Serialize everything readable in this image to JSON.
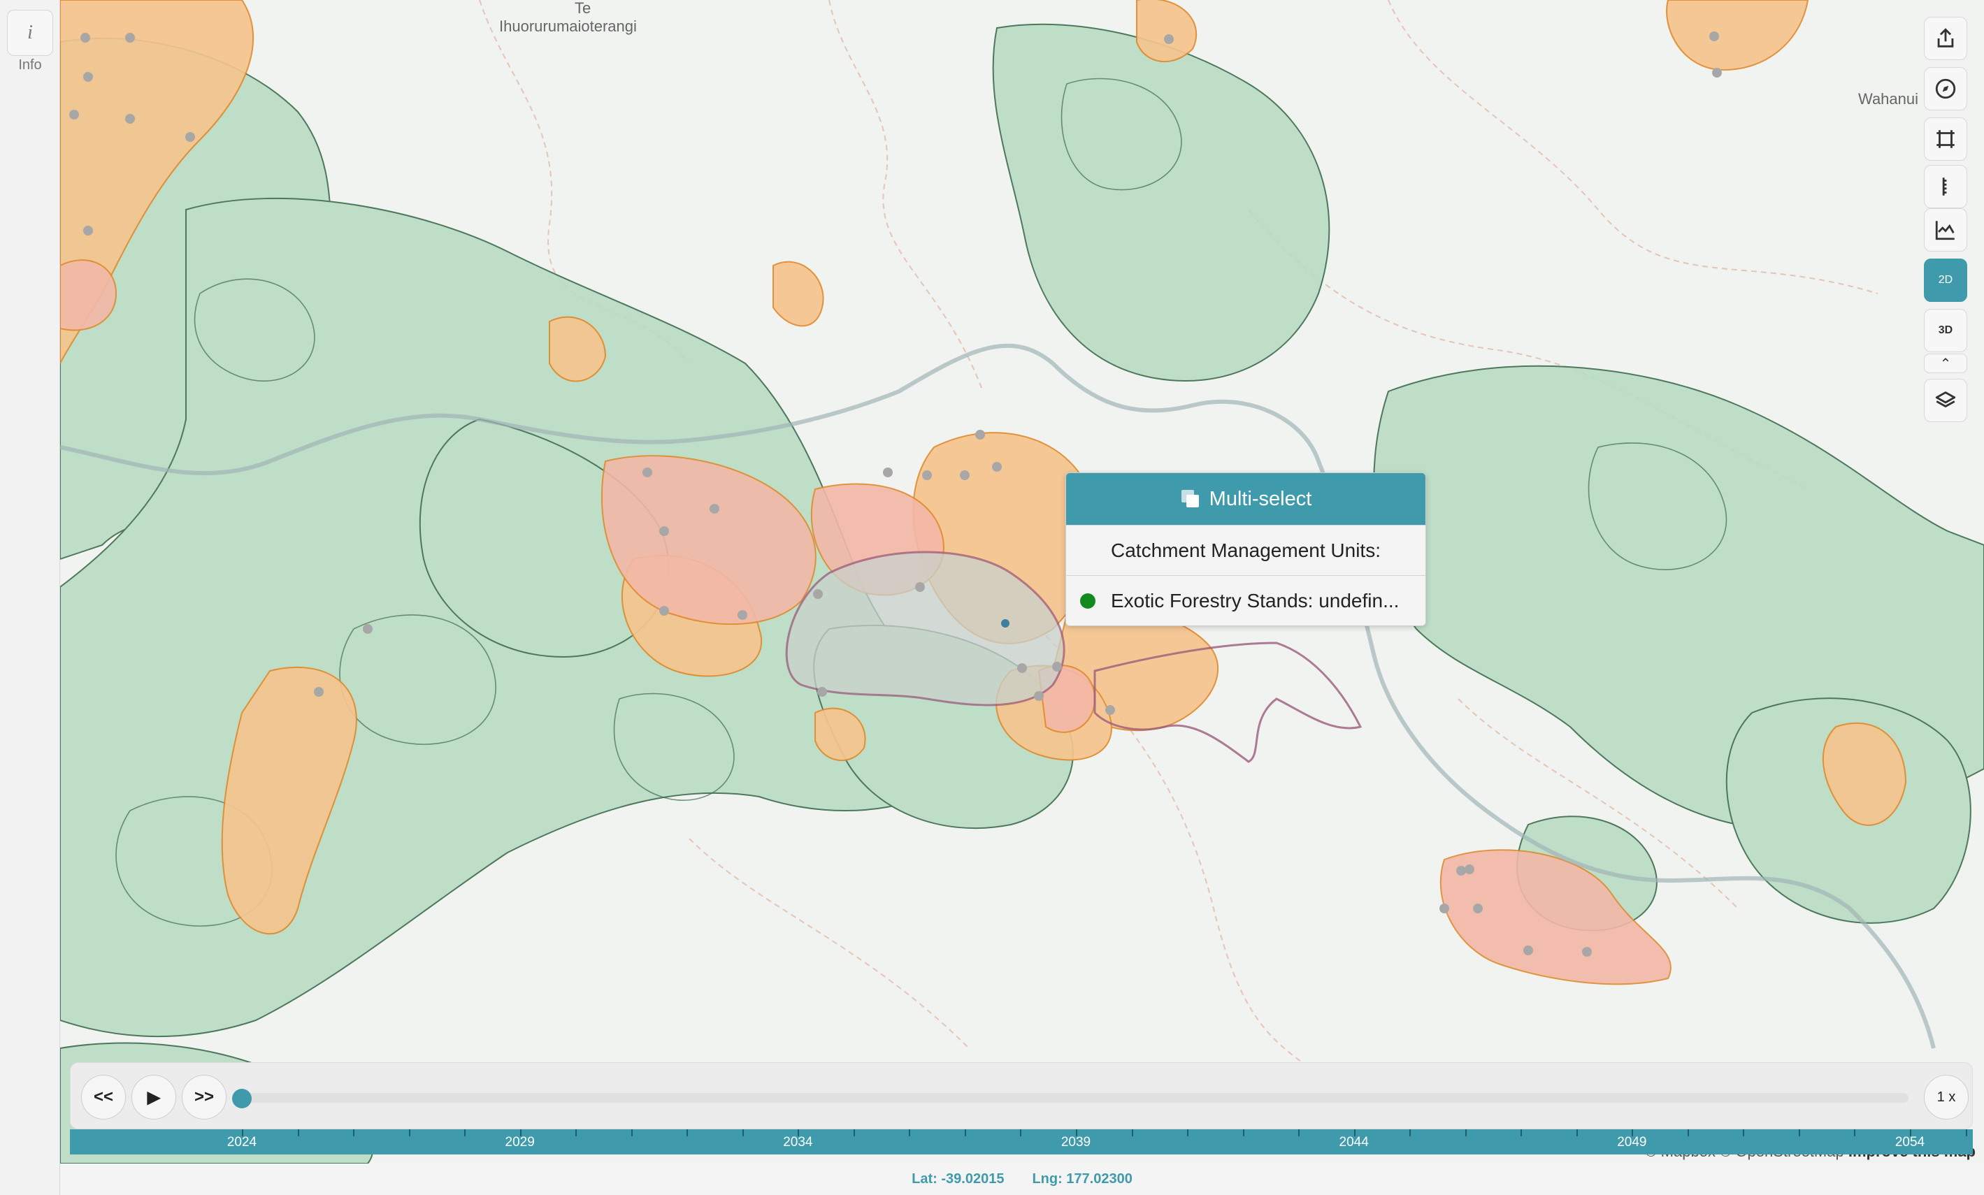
{
  "sidebar": {
    "info_icon": "i",
    "info_label": "Info"
  },
  "map": {
    "place_labels": [
      "Te",
      "Ihuorurumaioterangi",
      "Wahanui"
    ],
    "attribution": {
      "mapbox": "© Mapbox",
      "osm": "© OpenStreetMap",
      "improve": "Improve this map"
    },
    "legend_colors": {
      "native_forest": "#b9dcc3",
      "exotic_forest": "#f5c48e",
      "harvested": "#f3b8a6",
      "catchment_border": "#9b5b7c",
      "water": "#cfd8dc"
    }
  },
  "controls": [
    {
      "name": "share-icon"
    },
    {
      "name": "compass-icon"
    },
    {
      "name": "frame-icon"
    },
    {
      "name": "ruler-icon"
    },
    {
      "name": "elevation-profile-icon"
    },
    {
      "name": "2d-view-icon",
      "label": "2D",
      "active": true
    },
    {
      "name": "3d-view-icon",
      "label": "3D"
    },
    {
      "name": "chevron-up-icon"
    },
    {
      "name": "layers-icon"
    }
  ],
  "popup": {
    "title": "Multi-select",
    "rows": [
      {
        "label": "Catchment Management Units:"
      },
      {
        "label": "Exotic Forestry Stands: undefin...",
        "dot_color": "#138a1e"
      }
    ]
  },
  "timeline": {
    "rewind_label": "<<",
    "play_label": "▶",
    "forward_label": ">>",
    "speed_label": "1 x",
    "current_year": 2024,
    "years": [
      "2024",
      "2029",
      "2034",
      "2039",
      "2044",
      "2049",
      "2054"
    ]
  },
  "status": {
    "lat": "Lat: -39.02015",
    "lng": "Lng: 177.02300"
  }
}
